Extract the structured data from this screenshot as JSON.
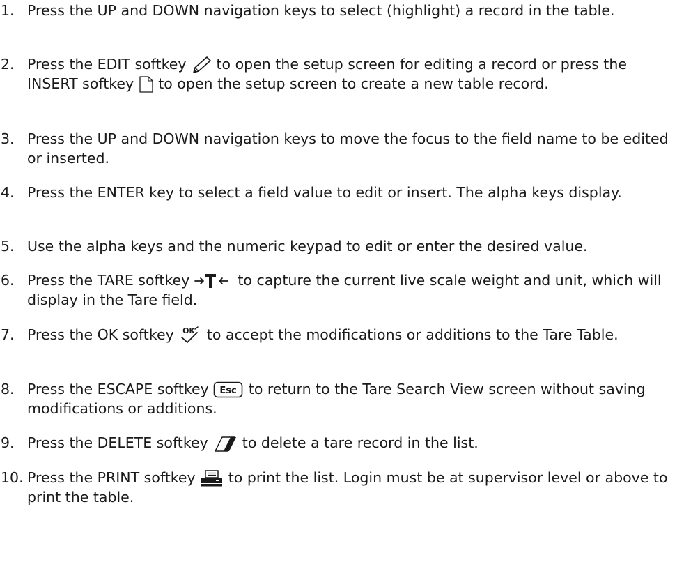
{
  "steps": [
    {
      "number": "1.",
      "text": [
        "Press the UP and DOWN navigation keys to select (highlight) a record in the table."
      ]
    },
    {
      "number": "2.",
      "text": [
        "Press the EDIT softkey",
        "to open the setup screen for editing a record or press the INSERT softkey",
        "to open the setup screen to create a new table record."
      ],
      "icons": [
        "pencil-icon",
        "blank-page-icon"
      ]
    },
    {
      "number": "3.",
      "text": [
        "Press the UP and DOWN navigation keys to move the focus to the field name to be edited or inserted."
      ]
    },
    {
      "number": "4.",
      "text": [
        "Press the ENTER key to select a field value to edit or insert. The alpha keys display."
      ]
    },
    {
      "number": "5.",
      "text": [
        "Use the alpha keys and the numeric keypad to edit or enter the desired value."
      ]
    },
    {
      "number": "6.",
      "text": [
        "Press the TARE softkey",
        "to capture the current live scale weight and unit, which will display in the Tare field."
      ],
      "icons": [
        "tare-icon"
      ]
    },
    {
      "number": "7.",
      "text": [
        "Press the OK softkey",
        "to accept the modifications or additions to the Tare Table."
      ],
      "icons": [
        "ok-check-icon"
      ],
      "icon_label": "OK"
    },
    {
      "number": "8.",
      "text": [
        "Press the ESCAPE softkey",
        "to return to the Tare Search View screen without saving modifications or additions."
      ],
      "icons": [
        "escape-key-icon"
      ],
      "icon_label": "Esc"
    },
    {
      "number": "9.",
      "text": [
        "Press the DELETE softkey",
        "to delete a tare record in the list."
      ],
      "icons": [
        "eraser-icon"
      ]
    },
    {
      "number": "10.",
      "text": [
        "Press the PRINT softkey",
        "to print the list. Login must be at supervisor level or above to print the table."
      ],
      "icons": [
        "printer-icon"
      ]
    }
  ]
}
